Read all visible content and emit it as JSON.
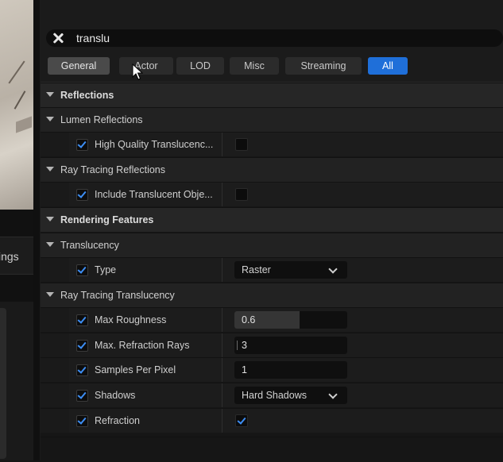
{
  "left": {
    "tab_label": "ings"
  },
  "search": {
    "value": "translu"
  },
  "tabs": [
    {
      "label": "General",
      "state": "hover"
    },
    {
      "label": "Actor",
      "state": "normal"
    },
    {
      "label": "LOD",
      "state": "normal"
    },
    {
      "label": "Misc",
      "state": "normal"
    },
    {
      "label": "Streaming",
      "state": "normal"
    },
    {
      "label": "All",
      "state": "active"
    }
  ],
  "details": {
    "reflections": {
      "label": "Reflections"
    },
    "lumen_reflections": {
      "label": "Lumen Reflections"
    },
    "hq_translucency": {
      "label": "High Quality Translucenc...",
      "override": true,
      "value": false
    },
    "rt_reflections": {
      "label": "Ray Tracing Reflections"
    },
    "include_translucent": {
      "label": "Include Translucent Obje...",
      "override": true,
      "value": false
    },
    "rendering_features": {
      "label": "Rendering Features"
    },
    "translucency": {
      "label": "Translucency"
    },
    "type": {
      "label": "Type",
      "override": true,
      "value": "Raster"
    },
    "rt_translucency": {
      "label": "Ray Tracing Translucency"
    },
    "max_roughness": {
      "label": "Max Roughness",
      "override": true,
      "value": "0.6",
      "fill_fraction": 0.58
    },
    "max_refraction_rays": {
      "label": "Max. Refraction Rays",
      "override": true,
      "value": "3"
    },
    "samples_per_pixel": {
      "label": "Samples Per Pixel",
      "override": true,
      "value": "1"
    },
    "shadows": {
      "label": "Shadows",
      "override": true,
      "value": "Hard Shadows"
    },
    "refraction": {
      "label": "Refraction",
      "override": true,
      "value": true
    }
  },
  "colors": {
    "accent": "#1f6fd9",
    "check": "#3d8ef5",
    "background": "#161616"
  }
}
